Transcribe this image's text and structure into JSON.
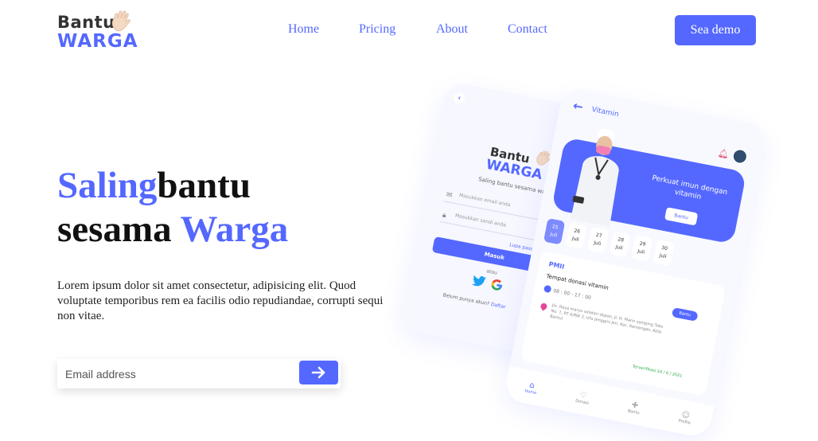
{
  "brand": {
    "line1": "Bantu",
    "line2": "WARGA",
    "hand_icon": "waving-hand-icon"
  },
  "nav": {
    "items": [
      {
        "label": "Home"
      },
      {
        "label": "Pricing"
      },
      {
        "label": "About"
      },
      {
        "label": "Contact"
      }
    ]
  },
  "header": {
    "demo_label": "Sea demo"
  },
  "hero": {
    "title_part1": "Saling",
    "title_part2": "bantu",
    "title_part3": "sesama ",
    "title_part4": "Warga",
    "description": "Lorem ipsum dolor sit amet consectetur, adipisicing elit. Quod voluptate temporibus rem ea facilis odio repudiandae, corrupti sequi non vitae."
  },
  "signup": {
    "placeholder": "Email address",
    "submit_icon": "arrow-right-icon"
  },
  "colors": {
    "accent": "#5468ff",
    "text": "#111111"
  },
  "phone_login": {
    "back_icon": "chevron-left-icon",
    "logo_line1": "Bantu",
    "logo_line2": "WARGA",
    "tagline": "Saling bantu sesama warga",
    "email_placeholder": "Masukkan email anda",
    "password_placeholder": "Masukkan sandi anda",
    "forgot": "Lupa password?",
    "login_label": "Masuk",
    "or": "atau",
    "register_text": "Belum punya akun?",
    "register_link": "Daftar"
  },
  "phone_vitamin": {
    "title": "Vitamin",
    "promo": "Perkuat imun dengan vitamin",
    "help_label": "Bantu",
    "dates": [
      {
        "day": "25",
        "month": "Juli",
        "active": true
      },
      {
        "day": "26",
        "month": "Juli",
        "active": false
      },
      {
        "day": "27",
        "month": "Juli",
        "active": false
      },
      {
        "day": "28",
        "month": "Juli",
        "active": false
      },
      {
        "day": "29",
        "month": "Juli",
        "active": false
      },
      {
        "day": "30",
        "month": "Juli",
        "active": false
      }
    ],
    "card": {
      "org": "PMII",
      "place": "Tempat donasi vitamin",
      "time": "08 : 00 - 17 : 00",
      "chip": "Bantu",
      "address": "Jln. Raya maryo selatan depan, Jl. H. Marin samping Toko No. 7, RT 6/RW 3, Ulis Jenggris Jen, Kec. Kemangan, Kota Bantul",
      "footer": "Terverifikasi 24 / 6 / 2021"
    },
    "bottom_nav": [
      {
        "label": "Home",
        "icon": "home-icon",
        "active": true
      },
      {
        "label": "Donasi",
        "icon": "donate-icon",
        "active": false
      },
      {
        "label": "Bantu",
        "icon": "help-icon",
        "active": false
      },
      {
        "label": "Profile",
        "icon": "user-icon",
        "active": false
      }
    ]
  }
}
